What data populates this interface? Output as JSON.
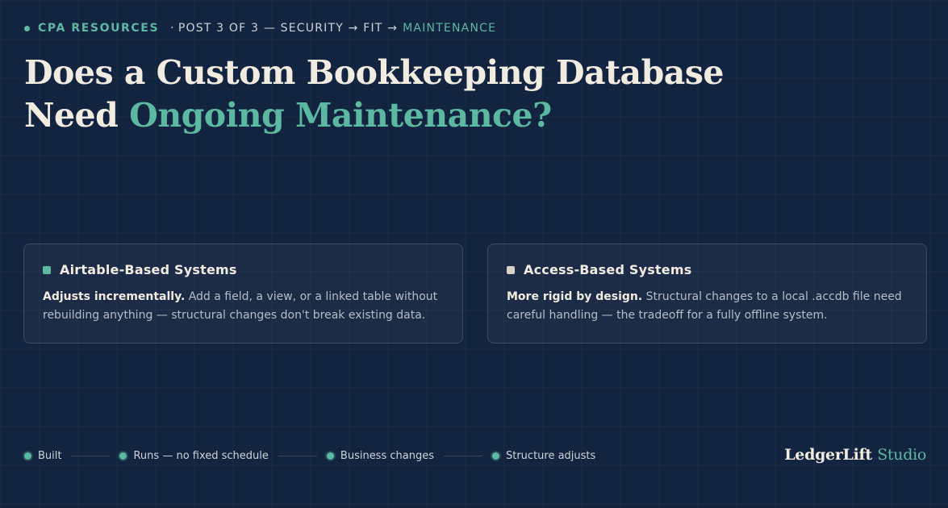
{
  "eyebrow": {
    "label": "CPA RESOURCES",
    "separator": "·",
    "series": "POST 3 OF 3 — SECURITY → FIT →",
    "current": "MAINTENANCE"
  },
  "title": {
    "line1": "Does a Custom Bookkeeping Database",
    "line2_plain": "Need",
    "line2_accent": "Ongoing Maintenance?"
  },
  "cards": [
    {
      "title": "Airtable-Based Systems",
      "lead": "Adjusts incrementally.",
      "body": "Add a field, a view, or a linked table without rebuilding anything — structural changes don't break existing data."
    },
    {
      "title": "Access-Based Systems",
      "lead": "More rigid by design.",
      "body": "Structural changes to a local .accdb file need careful handling — the tradeoff for a fully offline system."
    }
  ],
  "timeline": {
    "steps": [
      "Built",
      "Runs — no fixed schedule",
      "Business changes",
      "Structure adjusts"
    ]
  },
  "brand": {
    "name": "LedgerLift",
    "suffix": "Studio"
  },
  "colors": {
    "background": "#132440",
    "accent": "#5cb8a0",
    "text": "#f1ece1"
  }
}
